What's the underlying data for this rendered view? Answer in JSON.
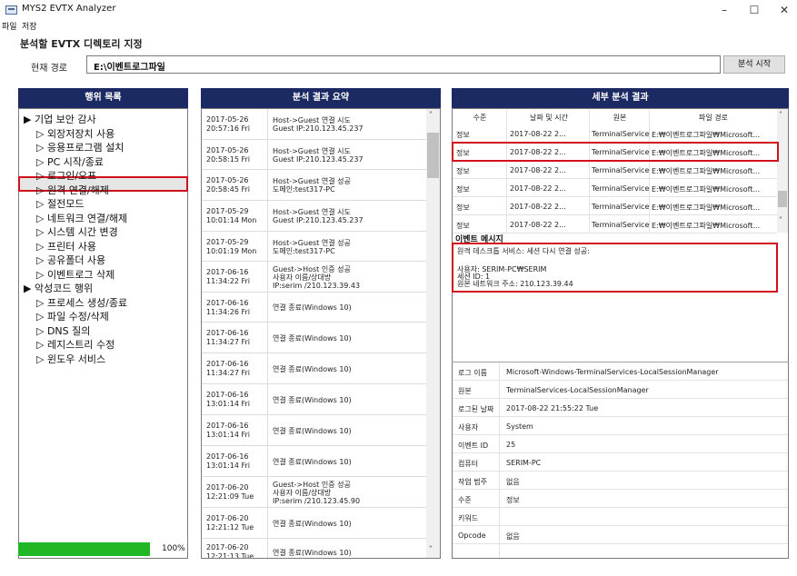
{
  "window": {
    "title": "MYS2 EVTX Analyzer",
    "minimize": "–",
    "maximize": "☐",
    "close": "✕"
  },
  "menu": [
    "파일",
    "저장"
  ],
  "dir_panel": {
    "title": "분석할 EVTX 디렉토리 지정",
    "path_label": "현재 경로",
    "path_value": "E:\\이벤트로그파일",
    "start_button": "분석 시작"
  },
  "tree": {
    "header": "행위 목록",
    "progress_value": 1.0,
    "progress_text": "100%",
    "groups": [
      {
        "label": "▶ 기업 보안 감사",
        "items": [
          "▷ 외장저장치 사용",
          "▷ 응용프로그램 설치",
          "▷ PC 시작/종료",
          "▷ 로그인/오프",
          "▷ 원격 연결/해제",
          "▷ 절전모드",
          "▷ 네트워크 연결/해제",
          "▷ 시스템 시간 변경",
          "▷ 프린터 사용",
          "▷ 공유폴더 사용",
          "▷ 이벤트로그 삭제"
        ]
      },
      {
        "label": "▶ 악성코드 행위",
        "items": [
          "▷ 프로세스 생성/종료",
          "▷ 파일 수정/삭제",
          "▷ DNS 질의",
          "▷ 레지스트리 수정",
          "▷ 윈도우 서비스"
        ]
      }
    ],
    "selected": "▷ 원격 연결/해제"
  },
  "summary": {
    "header": "분석 결과 요약",
    "rows": [
      {
        "date": "2017-05-26",
        "time": "20:57:16 Fri",
        "desc": [
          "Host->Guest 연결 시도",
          "Guest IP:210.123.45.237"
        ]
      },
      {
        "date": "2017-05-26",
        "time": "20:58:15 Fri",
        "desc": [
          "Host->Guest 연결 시도",
          "Guest IP:210.123.45.237"
        ]
      },
      {
        "date": "2017-05-26",
        "time": "20:58:45 Fri",
        "desc": [
          "Host->Guest 연결 성공",
          "도메인:test317-PC"
        ]
      },
      {
        "date": "2017-05-29",
        "time": "10:01:14 Mon",
        "desc": [
          "Host->Guest 연결 시도",
          "Guest IP:210.123.45.237"
        ]
      },
      {
        "date": "2017-05-29",
        "time": "10:01:19 Mon",
        "desc": [
          "Host->Guest 연결 성공",
          "도메인:test317-PC"
        ]
      },
      {
        "date": "2017-06-16",
        "time": "11:34:22 Fri",
        "desc": [
          "Guest->Host 인증 성공",
          "사용자 이름/상대방",
          "IP:serim /210.123.39.43"
        ]
      },
      {
        "date": "2017-06-16",
        "time": "11:34:26 Fri",
        "desc": [
          "연결 종료(Windows 10)"
        ]
      },
      {
        "date": "2017-06-16",
        "time": "11:34:27 Fri",
        "desc": [
          "연결 종료(Windows 10)"
        ]
      },
      {
        "date": "2017-06-16",
        "time": "11:34:27 Fri",
        "desc": [
          "연결 종료(Windows 10)"
        ]
      },
      {
        "date": "2017-06-16",
        "time": "13:01:14 Fri",
        "desc": [
          "연결 종료(Windows 10)"
        ]
      },
      {
        "date": "2017-06-16",
        "time": "13:01:14 Fri",
        "desc": [
          "연결 종료(Windows 10)"
        ]
      },
      {
        "date": "2017-06-16",
        "time": "13:01:14 Fri",
        "desc": [
          "연결 종료(Windows 10)"
        ]
      },
      {
        "date": "2017-06-20",
        "time": "12:21:09 Tue",
        "desc": [
          "Guest->Host 인증 성공",
          "사용자 이름/상대방",
          "IP:serim /210.123.45.90"
        ]
      },
      {
        "date": "2017-06-20",
        "time": "12:21:12 Tue",
        "desc": [
          "연결 종료(Windows 10)"
        ]
      },
      {
        "date": "2017-06-20",
        "time": "12:21:13 Tue",
        "desc": [
          "연결 종료(Windows 10)"
        ]
      }
    ]
  },
  "detail": {
    "header": "세부 분석 결과",
    "columns": [
      "수준",
      "날짜 및 시간",
      "원본",
      "파일 경로"
    ],
    "rows": [
      [
        "정보",
        "2017-08-22 2...",
        "TerminalService...",
        "E:₩이벤트로그파일₩Microsoft..."
      ],
      [
        "정보",
        "2017-08-22 2...",
        "TerminalService...",
        "E:₩이벤트로그파일₩Microsoft..."
      ],
      [
        "정보",
        "2017-08-22 2...",
        "TerminalService...",
        "E:₩이벤트로그파일₩Microsoft..."
      ],
      [
        "정보",
        "2017-08-22 2...",
        "TerminalService...",
        "E:₩이벤트로그파일₩Microsoft..."
      ],
      [
        "정보",
        "2017-08-22 2...",
        "TerminalService...",
        "E:₩이벤트로그파일₩Microsoft..."
      ],
      [
        "정보",
        "2017-08-22 2...",
        "TerminalService...",
        "E:₩이벤트로그파일₩Microsoft..."
      ]
    ],
    "message_label": "이벤트 메시지",
    "message_lines": [
      "원격 데스크톱 서비스: 세션 다시 연결 성공:",
      "",
      "사용자: SERIM-PC₩SERIM",
      "세션 ID: 1",
      "원본 네트워크 주소: 210.123.39.44"
    ],
    "properties": [
      [
        "로그 이름",
        "Microsoft-Windows-TerminalServices-LocalSessionManager"
      ],
      [
        "원본",
        "TerminalServices-LocalSessionManager"
      ],
      [
        "로그된 날짜",
        "2017-08-22 21:55:22 Tue"
      ],
      [
        "사용자",
        "System"
      ],
      [
        "이벤트 ID",
        "25"
      ],
      [
        "컴퓨터",
        "SERIM-PC"
      ],
      [
        "작업 범주",
        "없음"
      ],
      [
        "수준",
        "정보"
      ],
      [
        "키워드",
        ""
      ],
      [
        "Opcode",
        "없음"
      ]
    ]
  },
  "colors": {
    "header_bg": "#1c2a64",
    "selection": "#d0101c",
    "progress": "#1fb824"
  }
}
